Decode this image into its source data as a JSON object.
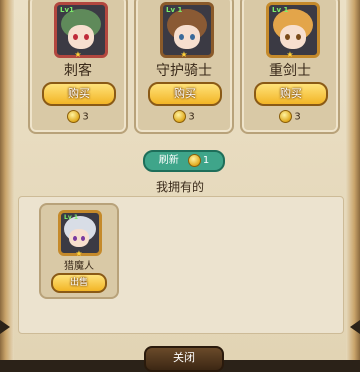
{
  "shop": {
    "items": [
      {
        "name": "刺客",
        "level": "Lv1",
        "buy_label": "购买",
        "price": "3",
        "icon": "assassin-portrait"
      },
      {
        "name": "守护骑士",
        "level": "Lv 1",
        "buy_label": "购买",
        "price": "3",
        "icon": "guardian-knight-portrait"
      },
      {
        "name": "重剑士",
        "level": "Lv 1",
        "buy_label": "购买",
        "price": "3",
        "icon": "heavy-swordsman-portrait"
      }
    ],
    "refresh_label": "刷新",
    "refresh_cost": "1"
  },
  "owned": {
    "title": "我拥有的",
    "items": [
      {
        "name": "猎魔人",
        "level": "Lv 1",
        "sell_label": "出售",
        "icon": "demon-hunter-portrait"
      }
    ]
  },
  "close_label": "关闭",
  "colors": {
    "panel_bg": "#e6d9bc",
    "button_gold": "#f2b526",
    "refresh_teal": "#3fa58a"
  }
}
